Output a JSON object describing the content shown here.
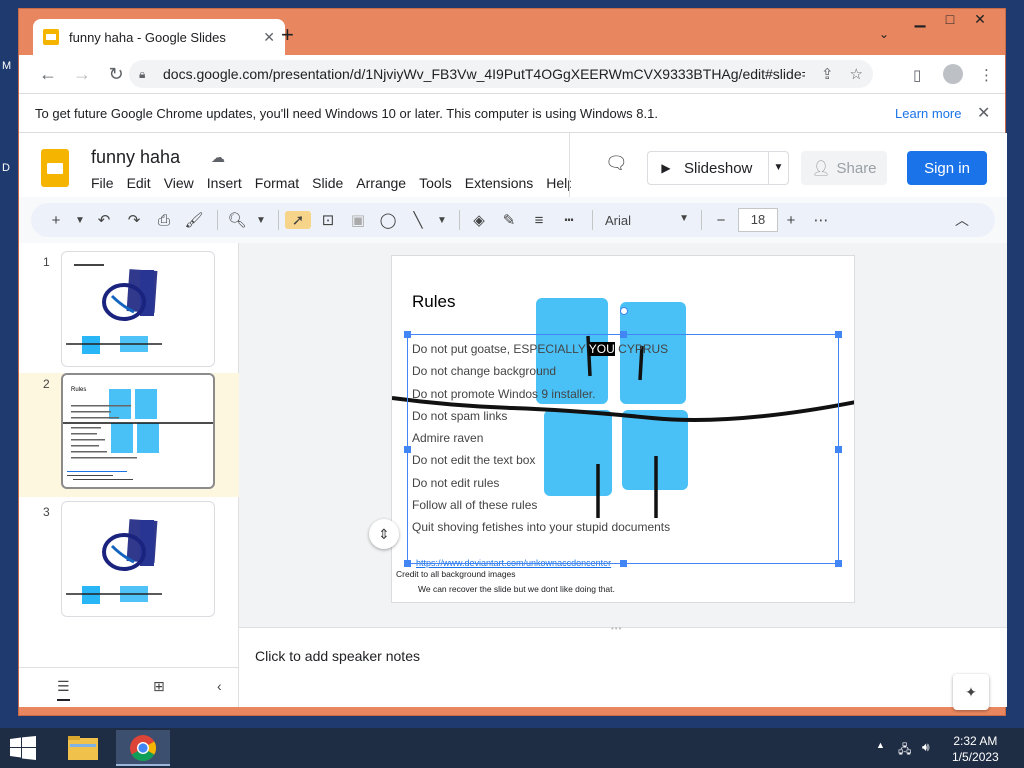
{
  "desktop": {
    "left_letters": [
      "M",
      "D"
    ]
  },
  "browser": {
    "tab_title": "funny haha - Google Slides",
    "url": "docs.google.com/presentation/d/1NjviyWv_FB3Vw_4I9PutT4OGgXEERWmCVX9333BTHAg/edit#slide=id.g...",
    "infobar": {
      "message": "To get future Google Chrome updates, you'll need Windows 10 or later. This computer is using Windows 8.1.",
      "learn_more": "Learn more"
    }
  },
  "slides": {
    "doc_title": "funny haha",
    "menu": [
      "File",
      "Edit",
      "View",
      "Insert",
      "Format",
      "Slide",
      "Arrange",
      "Tools",
      "Extensions",
      "Help"
    ],
    "slideshow_label": "Slideshow",
    "share_label": "Share",
    "signin_label": "Sign in",
    "font": "Arial",
    "font_size": "18",
    "filmstrip": [
      {
        "num": "1"
      },
      {
        "num": "2",
        "title": "Rules"
      },
      {
        "num": "3"
      }
    ],
    "current_slide": {
      "title": "Rules",
      "rules": [
        {
          "before": "Do not put goatse, ESPECIALLY ",
          "highlight": "YOU",
          "after": " CYPRUS"
        },
        {
          "text": "Do not change background"
        },
        {
          "text": "Do not promote Windos 9 installer."
        },
        {
          "text": "Do not spam links"
        },
        {
          "text": "Admire raven"
        },
        {
          "text": "Do not edit the text box"
        },
        {
          "text": "Do not edit rules"
        },
        {
          "text": "Follow all of these rules"
        },
        {
          "text": "Quit shoving fetishes into your stupid documents"
        }
      ],
      "link": "https://www.deviantart.com/unkownaccdoncenter",
      "credit": "Credit to all background images",
      "recover_note": "We can recover the slide but we dont like doing that."
    },
    "speaker_notes_placeholder": "Click to add speaker notes"
  },
  "taskbar": {
    "time": "2:32 AM",
    "date": "1/5/2023"
  },
  "colors": {
    "window_frame": "#e8875f",
    "accent_blue": "#1a73e8",
    "slides_yellow": "#f4b400",
    "selection_blue": "#4285f4",
    "film_active_bg": "#fef7e0",
    "taskbar": "#1f2d44"
  }
}
